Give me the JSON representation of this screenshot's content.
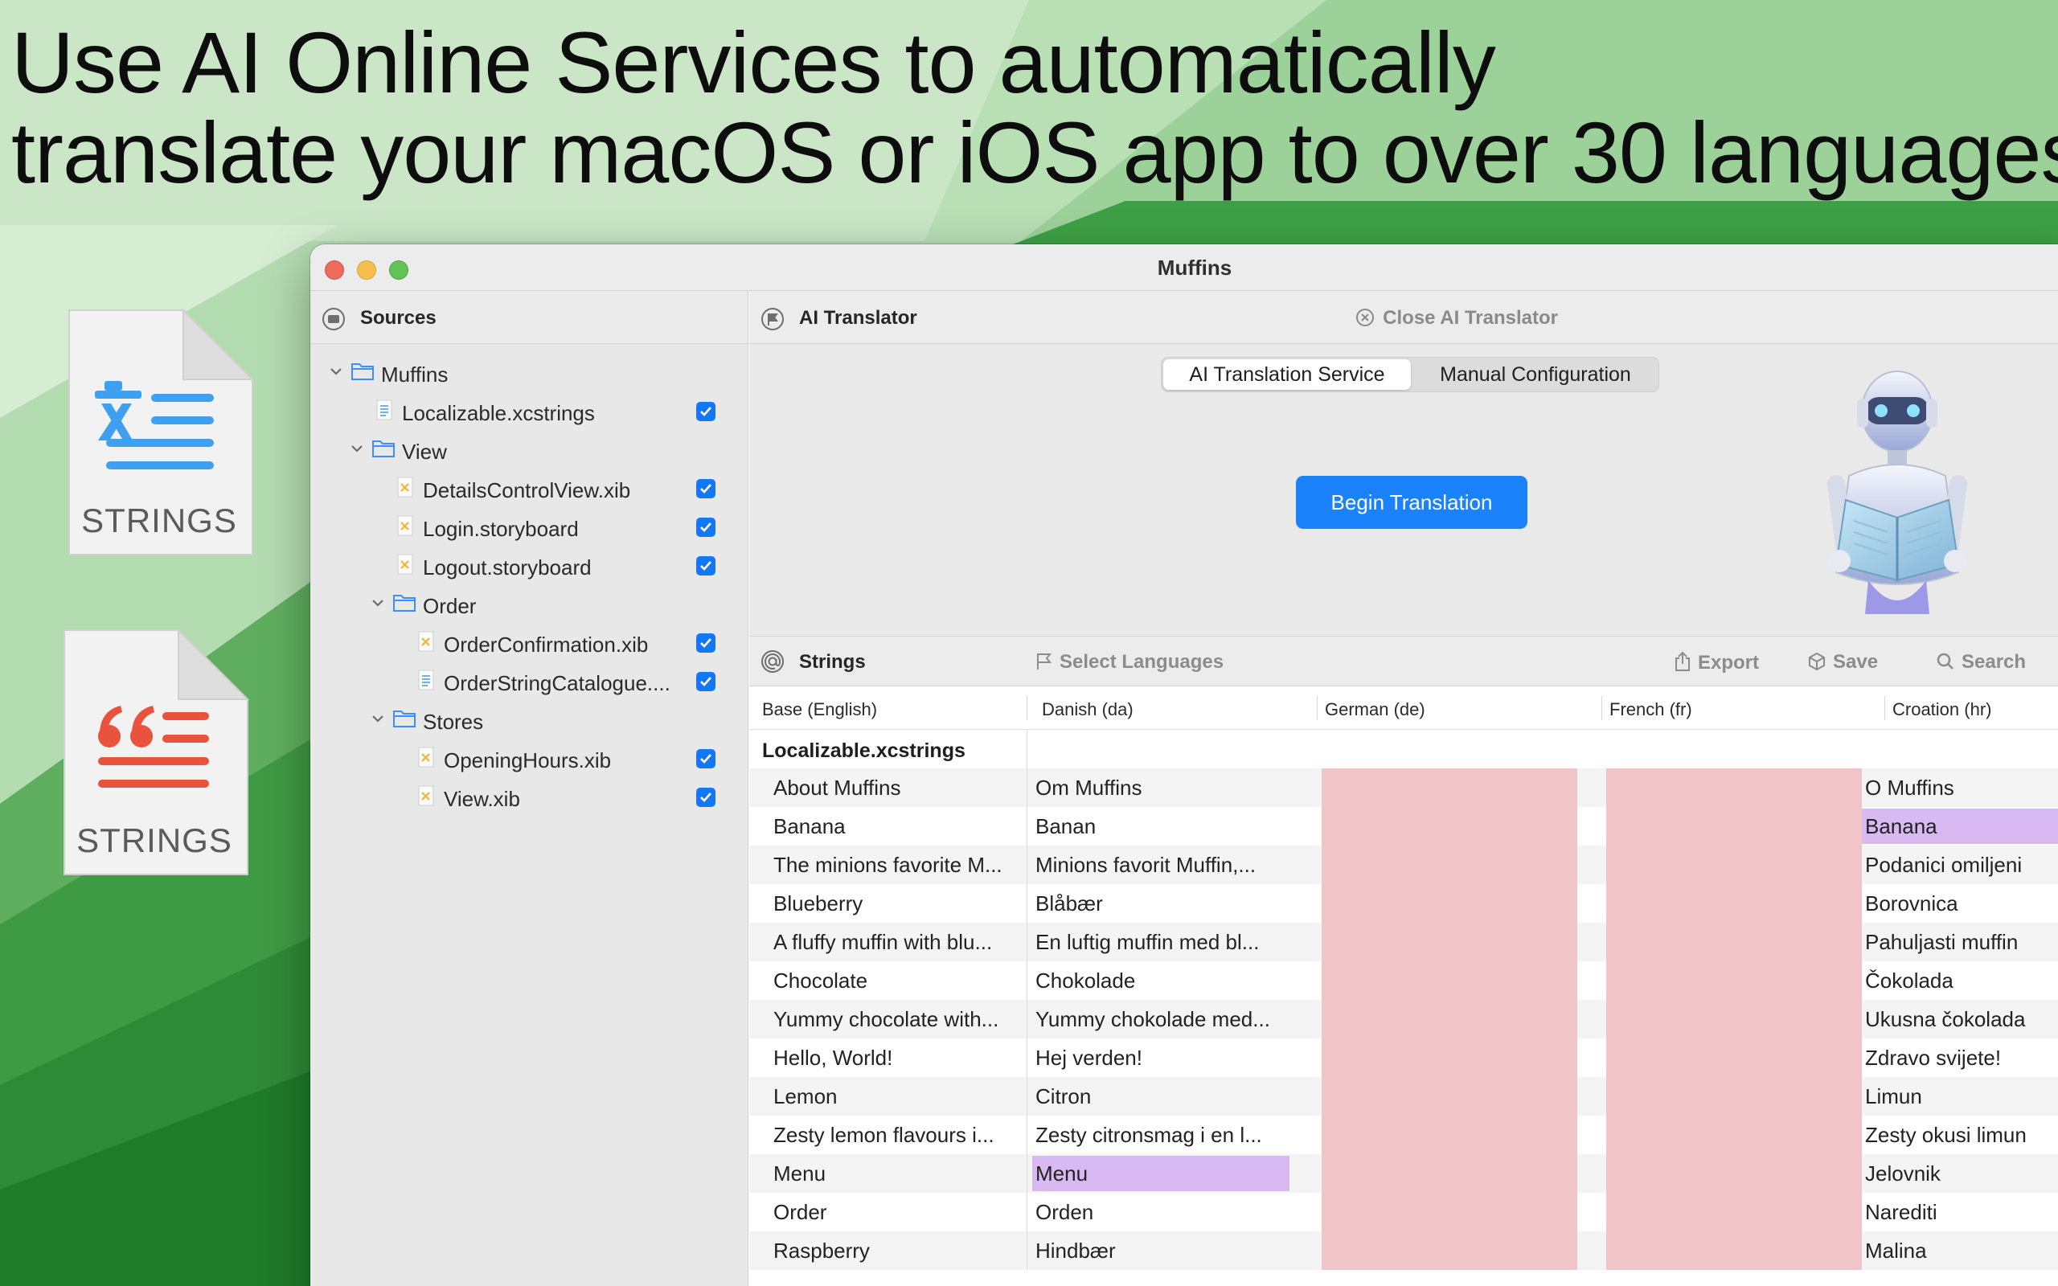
{
  "headline": {
    "line1": "Use AI Online Services to automatically",
    "line2": "translate your macOS or iOS app to over 30 languages."
  },
  "file_icons": [
    {
      "label": "STRINGS",
      "kind": "translation-symbol",
      "accent": "#3f9ff0"
    },
    {
      "label": "STRINGS",
      "kind": "quote-symbol",
      "accent": "#e9523d"
    }
  ],
  "window": {
    "title": "Muffins"
  },
  "sidebar": {
    "title": "Sources",
    "items": [
      {
        "label": "Muffins",
        "type": "folder",
        "expanded": true,
        "checked": null
      },
      {
        "label": "Localizable.xcstrings",
        "type": "strings-file",
        "checked": true
      },
      {
        "label": "View",
        "type": "folder",
        "expanded": true,
        "checked": null
      },
      {
        "label": "DetailsControlView.xib",
        "type": "xib-file",
        "checked": true
      },
      {
        "label": "Login.storyboard",
        "type": "xib-file",
        "checked": true
      },
      {
        "label": "Logout.storyboard",
        "type": "xib-file",
        "checked": true
      },
      {
        "label": "Order",
        "type": "folder",
        "expanded": true,
        "checked": null
      },
      {
        "label": "OrderConfirmation.xib",
        "type": "xib-file",
        "checked": true
      },
      {
        "label": "OrderStringCatalogue....",
        "type": "strings-file",
        "checked": true
      },
      {
        "label": "Stores",
        "type": "folder",
        "expanded": true,
        "checked": null
      },
      {
        "label": "OpeningHours.xib",
        "type": "xib-file",
        "checked": true
      },
      {
        "label": "View.xib",
        "type": "xib-file",
        "checked": true
      }
    ]
  },
  "ai_panel": {
    "title": "AI Translator",
    "close_label": "Close AI Translator",
    "tabs": [
      {
        "label": "AI Translation Service",
        "selected": true
      },
      {
        "label": "Manual Configuration",
        "selected": false
      }
    ],
    "begin_button": "Begin Translation"
  },
  "strings_panel": {
    "title": "Strings",
    "select_languages": "Select Languages",
    "export": "Export",
    "save": "Save",
    "search": "Search"
  },
  "table": {
    "columns": [
      "Base (English)",
      "Danish (da)",
      "German (de)",
      "French (fr)",
      "Croation (hr)"
    ],
    "group": "Localizable.xcstrings",
    "rows": [
      {
        "base": "About Muffins",
        "da": "Om Muffins",
        "hr": "O Muffins",
        "highlight": null
      },
      {
        "base": "Banana",
        "da": "Banan",
        "hr": "Banana",
        "highlight": "hr"
      },
      {
        "base": "The minions favorite M...",
        "da": "Minions favorit Muffin,...",
        "hr": "Podanici omiljeni",
        "highlight": null
      },
      {
        "base": "Blueberry",
        "da": "Blåbær",
        "hr": "Borovnica",
        "highlight": null
      },
      {
        "base": "A fluffy muffin with blu...",
        "da": "En luftig muffin med bl...",
        "hr": "Pahuljasti muffin",
        "highlight": null
      },
      {
        "base": "Chocolate",
        "da": "Chokolade",
        "hr": "Čokolada",
        "highlight": null
      },
      {
        "base": "Yummy chocolate with...",
        "da": "Yummy chokolade med...",
        "hr": "Ukusna čokolada",
        "highlight": null
      },
      {
        "base": "Hello, World!",
        "da": "Hej verden!",
        "hr": "Zdravo svijete!",
        "highlight": null
      },
      {
        "base": "Lemon",
        "da": "Citron",
        "hr": "Limun",
        "highlight": null
      },
      {
        "base": "Zesty lemon flavours i...",
        "da": "Zesty citronsmag i en l...",
        "hr": "Zesty okusi limun",
        "highlight": null
      },
      {
        "base": "Menu",
        "da": "Menu",
        "hr": "Jelovnik",
        "highlight": "da"
      },
      {
        "base": "Order",
        "da": "Orden",
        "hr": "Narediti",
        "highlight": null
      },
      {
        "base": "Raspberry",
        "da": "Hindbær",
        "hr": "Malina",
        "highlight": null
      }
    ],
    "missing_color": "#f1c5c8",
    "highlight_color": "#d9b9f2"
  },
  "colors": {
    "accent": "#1a82fb",
    "checkbox": "#1677f5",
    "folder": "#3d8ff5"
  }
}
